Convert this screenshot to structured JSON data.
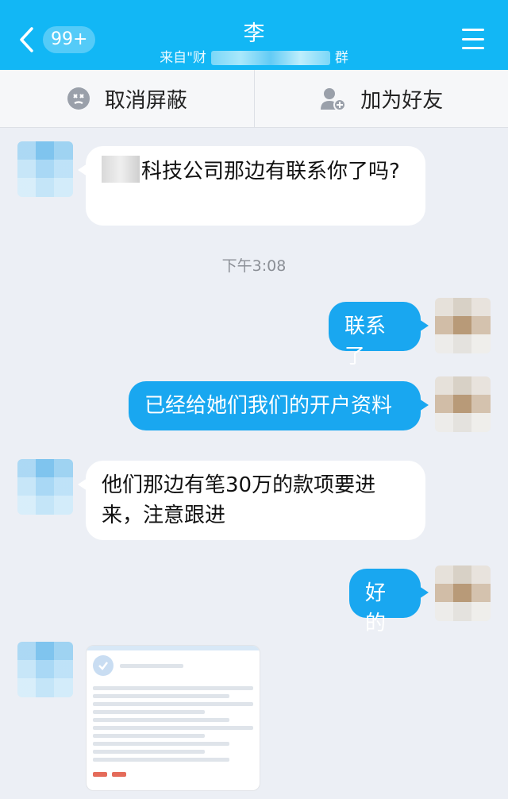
{
  "header": {
    "back_badge": "99+",
    "title": "李",
    "subtitle_prefix": "来自\"财",
    "subtitle_suffix": "群",
    "colors": {
      "bar": "#12b7f5"
    }
  },
  "actions": {
    "unblock_label": "取消屏蔽",
    "add_friend_label": "加为好友"
  },
  "messages": [
    {
      "side": "in",
      "text": "科技公司那边有联系你了吗?"
    },
    {
      "side": "out",
      "text": "联系了"
    },
    {
      "side": "out",
      "text": "已经给她们我们的开户资料"
    },
    {
      "side": "in",
      "text_line1": "他们那边有笔30万的款项要进",
      "text_line2": "来，注意跟进"
    },
    {
      "side": "out",
      "text": "好的"
    }
  ],
  "timestamp": "下午3:08",
  "colors": {
    "incoming_bubble": "#ffffff",
    "outgoing_bubble": "#19a7f0",
    "background": "#eceff5"
  }
}
